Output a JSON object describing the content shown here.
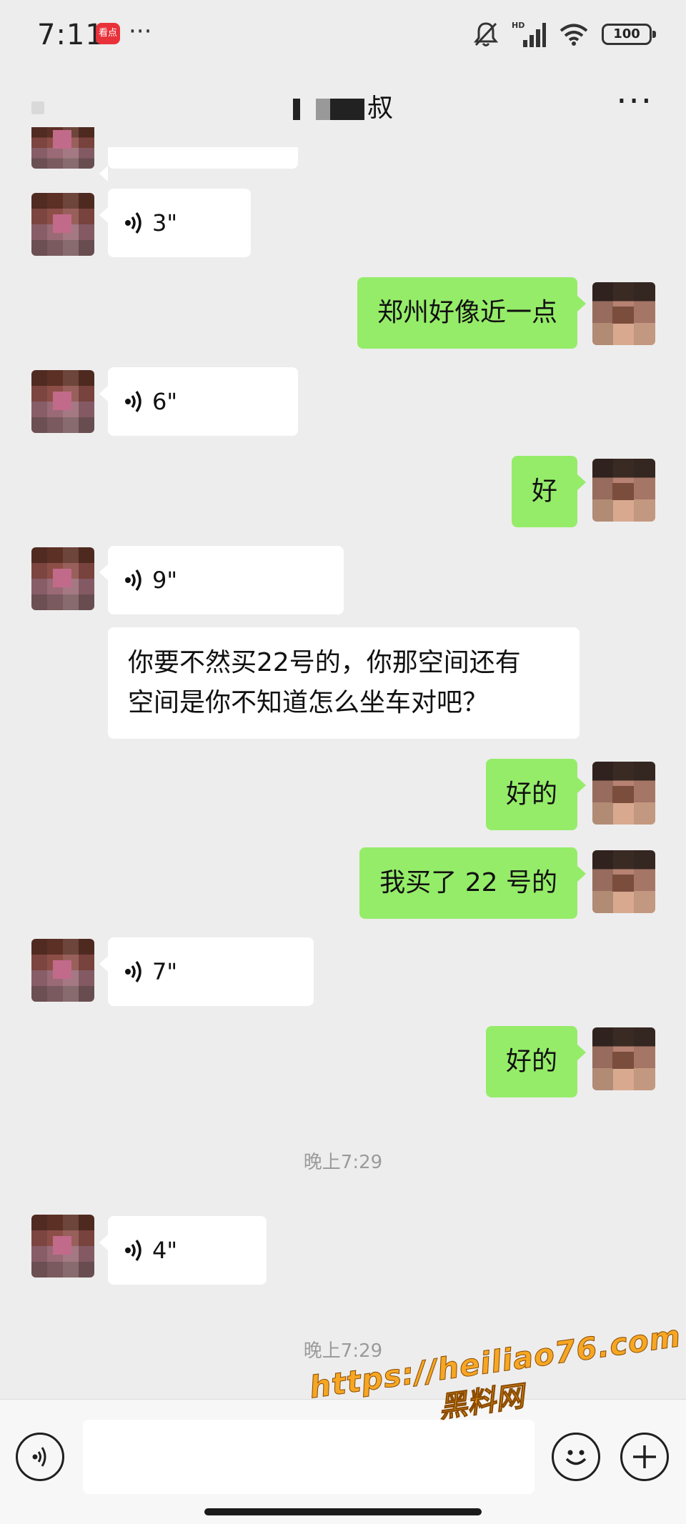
{
  "status_bar": {
    "time": "7:11",
    "app_badge": "看点",
    "more": "···",
    "battery": "100",
    "hd_label": "HD"
  },
  "nav": {
    "title": "叔",
    "more_icon": "more-horizontal-icon"
  },
  "messages": [
    {
      "side": "left",
      "type": "voice",
      "duration": "3\""
    },
    {
      "side": "right",
      "type": "text",
      "text": "郑州好像近一点"
    },
    {
      "side": "left",
      "type": "voice",
      "duration": "6\""
    },
    {
      "side": "right",
      "type": "text",
      "text": "好"
    },
    {
      "side": "left",
      "type": "voice",
      "duration": "9\""
    },
    {
      "side": "left",
      "type": "text",
      "lines": [
        "你要不然买22号的，你那空间还有",
        "空间是你不知道怎么坐车对吧？"
      ]
    },
    {
      "side": "right",
      "type": "text",
      "text": "好的"
    },
    {
      "side": "right",
      "type": "text",
      "text": "我买了 22 号的"
    },
    {
      "side": "left",
      "type": "voice",
      "duration": "7\""
    },
    {
      "side": "right",
      "type": "text",
      "text": "好的"
    },
    {
      "type": "time",
      "text": "晚上7:29"
    },
    {
      "side": "left",
      "type": "voice",
      "duration": "4\""
    },
    {
      "type": "time",
      "text": "晚上7:29"
    }
  ],
  "input_bar": {
    "voice_button_icon": "voice-icon",
    "emoji_button_icon": "smile-icon",
    "plus_button_icon": "plus-icon",
    "input_value": ""
  },
  "watermark": {
    "url": "https://heiliao76.com",
    "name": "黑料网"
  },
  "colors": {
    "background": "#ededed",
    "outgoing_bubble": "#95ec69",
    "incoming_bubble": "#ffffff",
    "timestamp": "#9b9b9b",
    "watermark": "#f6a623"
  }
}
